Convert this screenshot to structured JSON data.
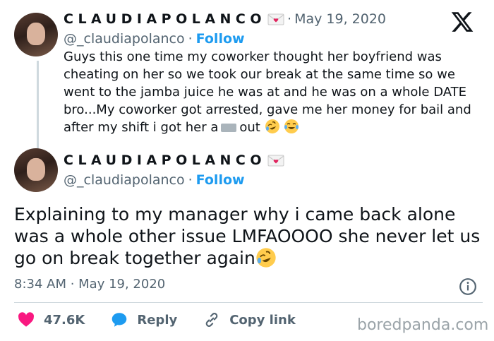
{
  "tweet1": {
    "display_name": "CLAUDIAPOLANCO",
    "separator": "·",
    "date": "May 19, 2020",
    "handle": "@_claudiapolanco",
    "handle_separator": "·",
    "follow_label": "Follow",
    "text_before_censor": "Guys this one time my coworker thought her boyfriend was cheating on her so we took our break at the same time so we went to the jamba juice he was at and he was on a whole DATE bro...My coworker got arrested, gave me her money for bail and after my shift i got her a",
    "text_after_censor": "out",
    "emojis": [
      "rolling-on-floor-laughing",
      "face-with-tears-of-joy"
    ]
  },
  "tweet2": {
    "display_name": "CLAUDIAPOLANCO",
    "handle": "@_claudiapolanco",
    "handle_separator": "·",
    "follow_label": "Follow",
    "text": "Explaining to my manager why i came back alone was a whole other issue LMFAOOOO she never let us go on break together again",
    "emoji": "rolling-on-floor-laughing",
    "timestamp": "8:34 AM · May 19, 2020",
    "likes": "47.6K",
    "reply_label": "Reply",
    "copy_link_label": "Copy link"
  },
  "watermark": "boredpanda.com",
  "colors": {
    "accent": "#1d9bf0",
    "like": "#f91880",
    "muted": "#536471",
    "text": "#0f1419"
  }
}
